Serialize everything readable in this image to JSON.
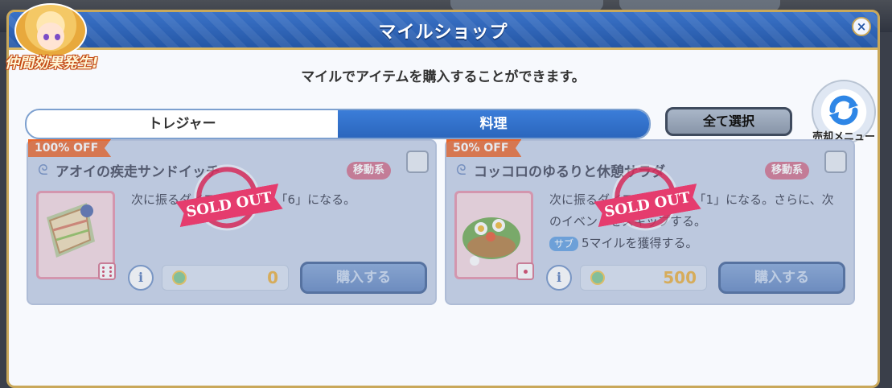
{
  "window": {
    "title": "マイルショップ"
  },
  "description": "マイルでアイテムを購入することができます。",
  "badge": "仲間効果発生!",
  "tabs": [
    {
      "label": "トレジャー",
      "active": false
    },
    {
      "label": "料理",
      "active": true
    }
  ],
  "select_all_label": "全て選択",
  "sell_menu_label": "売却メニュー",
  "items": [
    {
      "discount": "100% OFF",
      "name": "アオイの疾走サンドイッチ",
      "tag": "移動系",
      "description": "次に振るダイスの目が必ず「6」になる。",
      "sub_tag": "",
      "sub_text": "",
      "price": "0",
      "buy_label": "購入する",
      "sold_out_label": "SOLD OUT"
    },
    {
      "discount": "50% OFF",
      "name": "コッコロのゆるりと休憩サラダ",
      "tag": "移動系",
      "description": "次に振るダイスの目が必ず「1」になる。さらに、次のイベントをスキップする。",
      "sub_tag": "サブ",
      "sub_text": "5マイルを獲得する。",
      "price": "500",
      "buy_label": "購入する",
      "sold_out_label": "SOLD OUT"
    }
  ],
  "colors": {
    "accent": "#2b66bd",
    "price": "#e8ad3a",
    "discount": "#e9662c",
    "sold_out": "#e53c6e"
  },
  "icons": {
    "close": "close-icon",
    "refresh": "refresh-icon",
    "info": "info-icon",
    "mile": "mile-icon"
  }
}
